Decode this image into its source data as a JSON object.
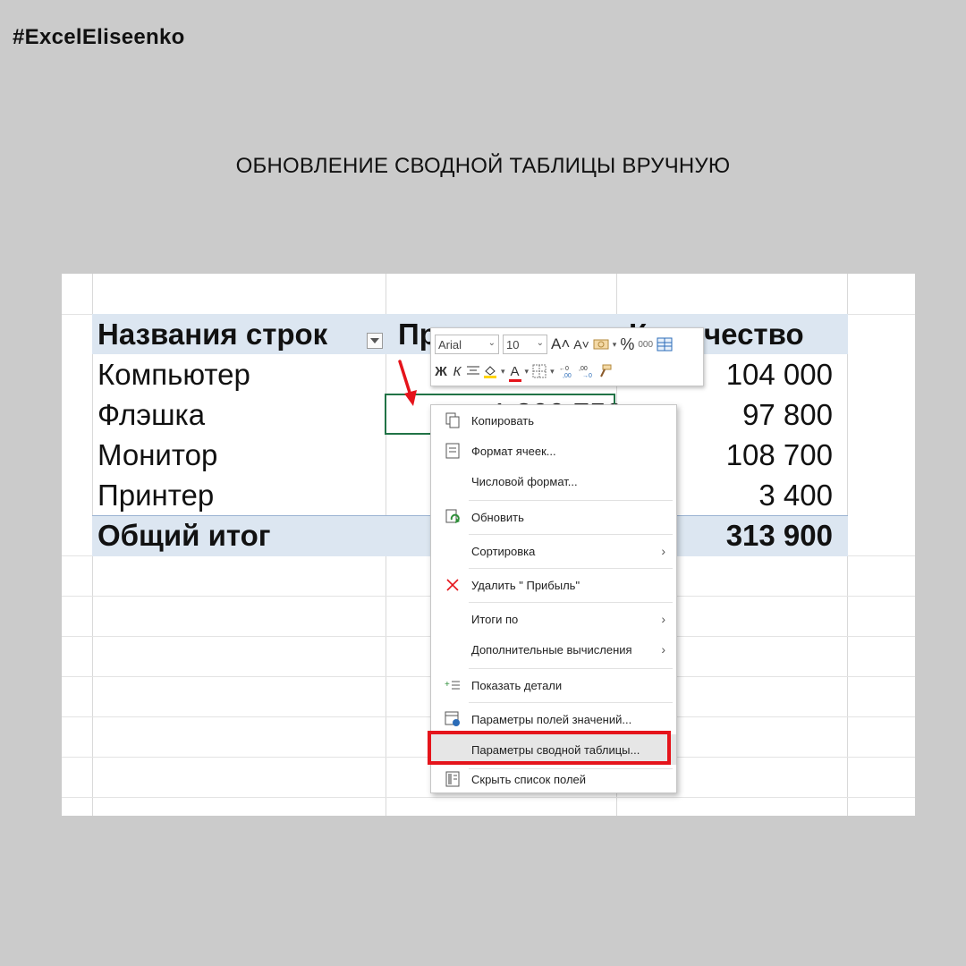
{
  "watermark": "#ExcelEliseenko",
  "headline": "ОБНОВЛЕНИЕ СВОДНОЙ ТАБЛИЦЫ ВРУЧНУЮ",
  "pivot": {
    "col1_header": "Названия строк",
    "col2_header_visible": "Пр",
    "col3_header_visible": "К",
    "col3_header_tail": "чество",
    "rows": [
      {
        "name": "Компьютер",
        "qty": "104 000"
      },
      {
        "name": "Флэшка",
        "qty": "97 800"
      },
      {
        "name": "Монитор",
        "qty": "108 700"
      },
      {
        "name": "Принтер",
        "qty": "3 400"
      }
    ],
    "total_label": "Общий итог",
    "total_qty": "313 900",
    "active_cell_partial": "1 300 750"
  },
  "mini_toolbar": {
    "font_name": "Arial",
    "font_size": "10",
    "grow_font": "A˄",
    "shrink_font": "A˅",
    "percent": "%",
    "thousands": "000",
    "bold": "Ж",
    "italic": "К",
    "font_color_letter": "А"
  },
  "context_menu": {
    "items": [
      {
        "label": "Копировать",
        "icon": "copy-icon"
      },
      {
        "label": "Формат ячеек...",
        "icon": "format-cells-icon"
      },
      {
        "label": "Числовой формат...",
        "icon": ""
      },
      {
        "label": "Обновить",
        "icon": "refresh-icon"
      },
      {
        "label": "Сортировка",
        "icon": "",
        "submenu": true
      },
      {
        "label": "Удалить \" Прибыль\"",
        "icon": "delete-x-icon"
      },
      {
        "label": "Итоги по",
        "icon": "",
        "submenu": true
      },
      {
        "label": "Дополнительные вычисления",
        "icon": "",
        "submenu": true
      },
      {
        "label": "Показать детали",
        "icon": "show-details-icon"
      },
      {
        "label": "Параметры полей значений...",
        "icon": "field-settings-icon"
      },
      {
        "label": "Параметры сводной таблицы...",
        "icon": "",
        "highlighted": true
      },
      {
        "label": "Скрыть список полей",
        "icon": "field-list-icon"
      }
    ]
  },
  "colors": {
    "background": "#cbcbcb",
    "pivot_header_fill": "#dce6f1",
    "highlight_border": "#e5141b",
    "active_cell_border": "#217346",
    "arrow": "#e5141b"
  }
}
